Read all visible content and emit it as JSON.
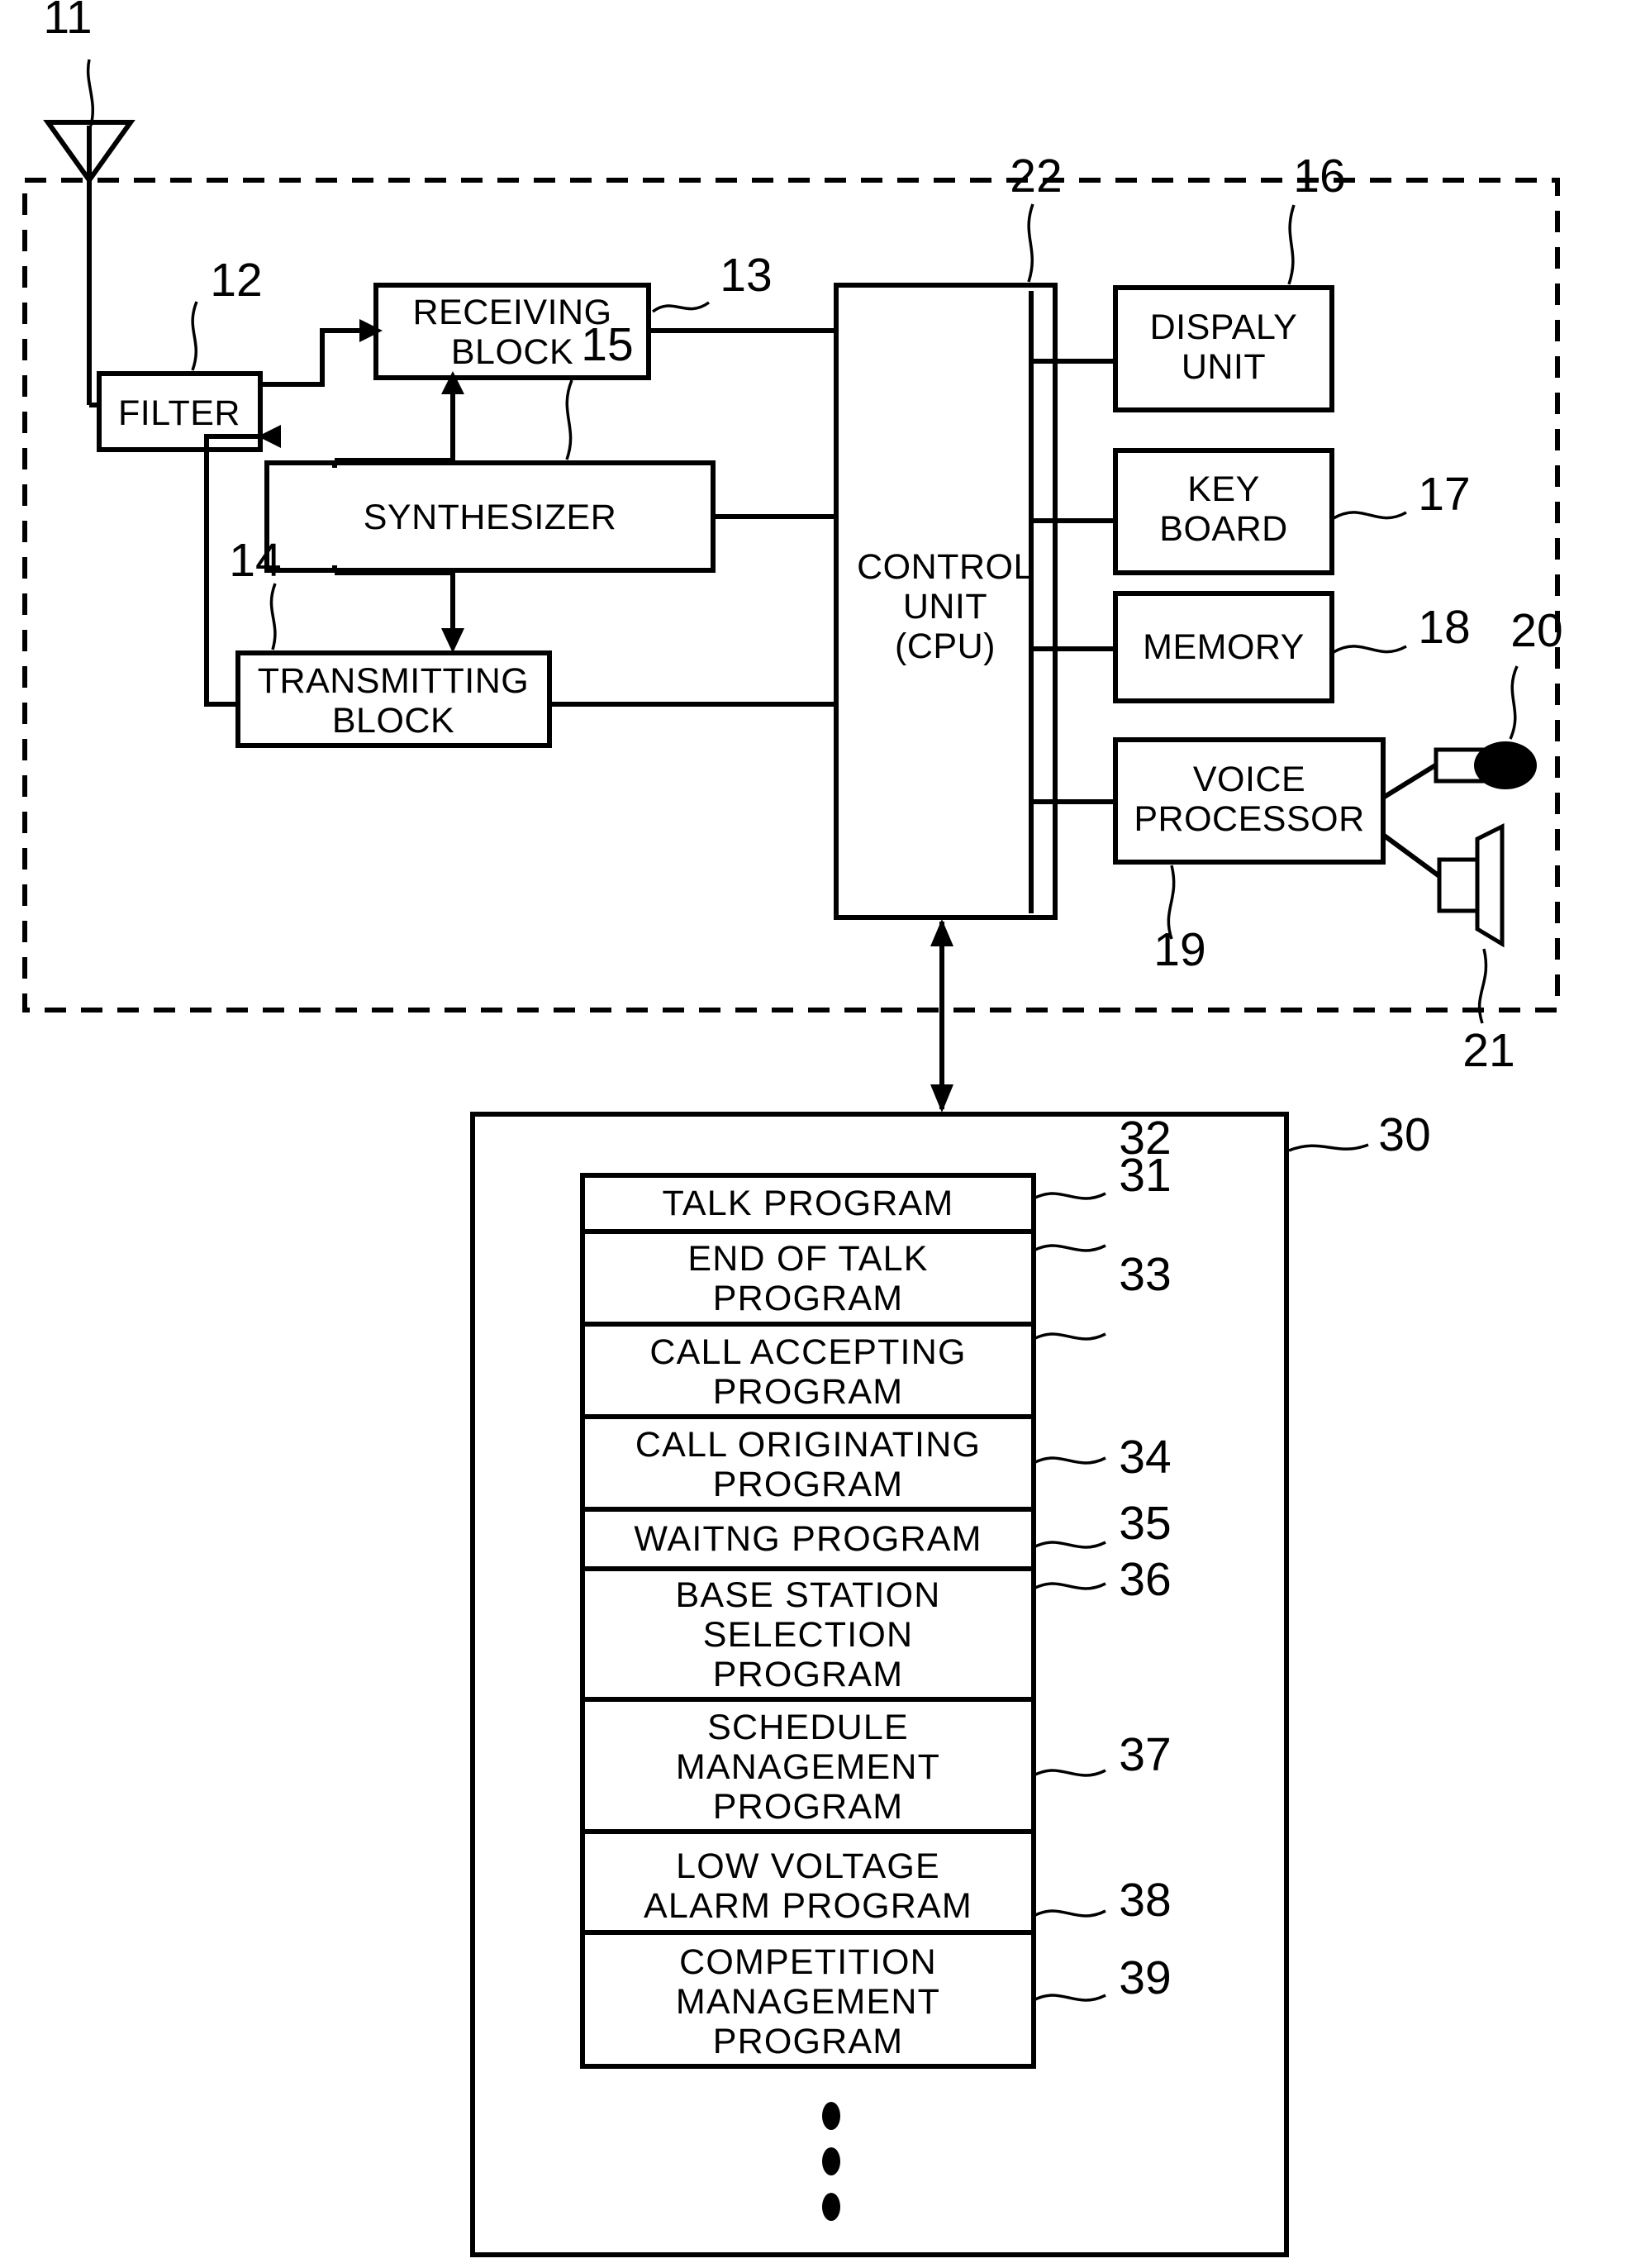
{
  "figure": {
    "type": "patent-block-diagram",
    "title": "Mobile communication terminal block diagram"
  },
  "device": {
    "enclosure_ref": "",
    "blocks": [
      {
        "id": "filter",
        "label": "FILTER",
        "ref": "12"
      },
      {
        "id": "receiving",
        "label_line1": "RECEIVING",
        "label_line2": "BLOCK",
        "ref": "13"
      },
      {
        "id": "transmitting",
        "label_line1": "TRANSMITTING",
        "label_line2": "BLOCK",
        "ref": "14"
      },
      {
        "id": "synthesizer",
        "label": "SYNTHESIZER",
        "ref": "15"
      },
      {
        "id": "display",
        "label_line1": "DISPALY",
        "label_line2": "UNIT",
        "ref": "16"
      },
      {
        "id": "keyboard",
        "label_line1": "KEY",
        "label_line2": "BOARD",
        "ref": "17"
      },
      {
        "id": "memory",
        "label": "MEMORY",
        "ref": "18"
      },
      {
        "id": "voice",
        "label_line1": "VOICE",
        "label_line2": "PROCESSOR",
        "ref": "19"
      },
      {
        "id": "control",
        "label_line1": "CONTROL",
        "label_line2": "UNIT",
        "label_line3": "(CPU)",
        "ref": "22"
      }
    ],
    "antenna": {
      "label": "antenna",
      "ref": "11"
    },
    "microphone": {
      "label": "microphone",
      "ref": "20"
    },
    "speaker": {
      "label": "speaker",
      "ref": "21"
    }
  },
  "program_store": {
    "ref": "30",
    "continuation": "⋮",
    "programs": [
      {
        "ref": "31",
        "lines": [
          "TALK PROGRAM"
        ]
      },
      {
        "ref": "32",
        "lines": [
          "END OF TALK",
          "PROGRAM"
        ]
      },
      {
        "ref": "33",
        "lines": [
          "CALL ACCEPTING",
          "PROGRAM"
        ]
      },
      {
        "ref": "34",
        "lines": [
          "CALL ORIGINATING",
          "PROGRAM"
        ]
      },
      {
        "ref": "35",
        "lines": [
          "WAITNG PROGRAM"
        ]
      },
      {
        "ref": "36",
        "lines": [
          "BASE STATION",
          "SELECTION",
          "PROGRAM"
        ]
      },
      {
        "ref": "37",
        "lines": [
          "SCHEDULE",
          "MANAGEMENT",
          "PROGRAM"
        ]
      },
      {
        "ref": "38",
        "lines": [
          "LOW VOLTAGE",
          "ALARM PROGRAM"
        ]
      },
      {
        "ref": "39",
        "lines": [
          "COMPETITION",
          "MANAGEMENT",
          "PROGRAM"
        ]
      }
    ]
  },
  "colors": {
    "ink": "#000000",
    "paper": "#ffffff"
  }
}
